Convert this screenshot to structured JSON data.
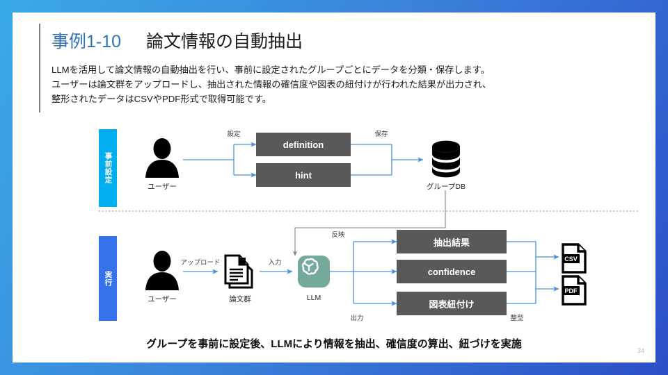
{
  "slide": {
    "page_number": "34",
    "title_accent": "事例1-10",
    "title_main": "論文情報の自動抽出",
    "lead_line1": "LLMを活用して論文情報の自動抽出を行い、事前に設定されたグループごとにデータを分類・保存します。",
    "lead_line2": "ユーザーは論文群をアップロードし、抽出された情報の確信度や図表の紐付けが行われた結果が出力され、",
    "lead_line3": "整形されたデータはCSVやPDF形式で取得可能です。",
    "footer_note": "グループを事前に設定後、LLMにより情報を抽出、確信度の算出、紐づけを実施"
  },
  "colors": {
    "accent_cyan": "#00adef",
    "accent_blue": "#3573ed",
    "title_blue": "#2e75b6",
    "box_gray": "#595959",
    "arrow_blue": "#4a90d9",
    "arrow_gray": "#808080",
    "llm_green": "#74aa9c",
    "border_gradient_from": "#39a9e6",
    "border_gradient_to": "#2c4fc6"
  },
  "setup_row": {
    "band_label": "事前設定",
    "user_caption": "ユーザー",
    "arrow_label_settei": "設定",
    "arrow_label_hozon": "保存",
    "boxes": [
      {
        "label": "definition"
      },
      {
        "label": "hint"
      }
    ],
    "db_caption": "グループDB",
    "db_icon": "database-icon",
    "user_icon": "user-avatar-icon"
  },
  "run_row": {
    "band_label": "実行",
    "user_caption": "ユーザー",
    "arrow_label_upload": "アップロード",
    "papers_caption": "論文群",
    "papers_icon": "documents-stack-icon",
    "arrow_label_input": "入力",
    "llm_caption": "LLM",
    "llm_icon": "openai-logo-icon",
    "arrow_label_hanei": "反映",
    "arrow_label_shutsuryoku": "出力",
    "result_boxes": [
      {
        "label": "抽出結果"
      },
      {
        "label": "confidence"
      },
      {
        "label": "図表紐付け"
      }
    ],
    "arrow_label_seikei": "整型",
    "outputs": [
      {
        "label": "CSV",
        "icon": "csv-file-icon"
      },
      {
        "label": "PDF",
        "icon": "pdf-file-icon"
      }
    ]
  }
}
